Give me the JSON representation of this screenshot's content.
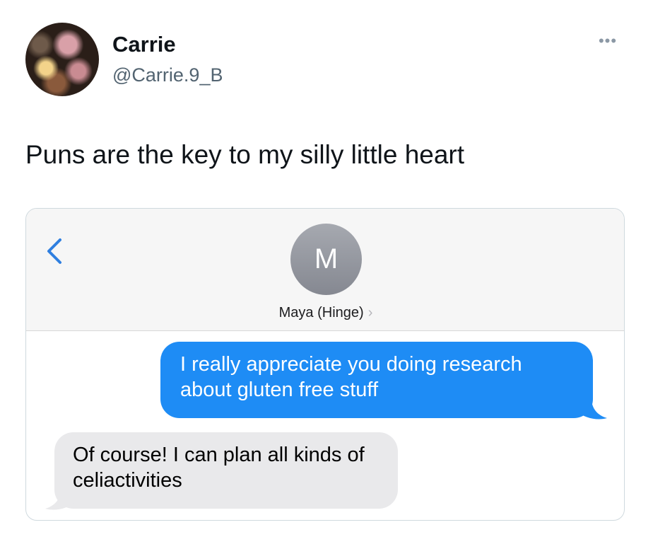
{
  "tweet": {
    "author_name": "Carrie",
    "author_handle": "@Carrie.9_B",
    "more_icon": "more-icon",
    "text": "Puns are the key to my silly little heart"
  },
  "screenshot": {
    "back_icon": "chevron-left-icon",
    "contact_initial": "M",
    "contact_name": "Maya (Hinge)",
    "contact_chevron": "›",
    "messages": [
      {
        "direction": "outgoing",
        "text": "I really appreciate you doing research about gluten free stuff"
      },
      {
        "direction": "incoming",
        "text": "Of course! I can plan all kinds of celiactivities"
      }
    ],
    "colors": {
      "outgoing_bubble": "#1e8cf5",
      "incoming_bubble": "#e9e9eb",
      "ios_blue": "#2f7fe0"
    }
  }
}
